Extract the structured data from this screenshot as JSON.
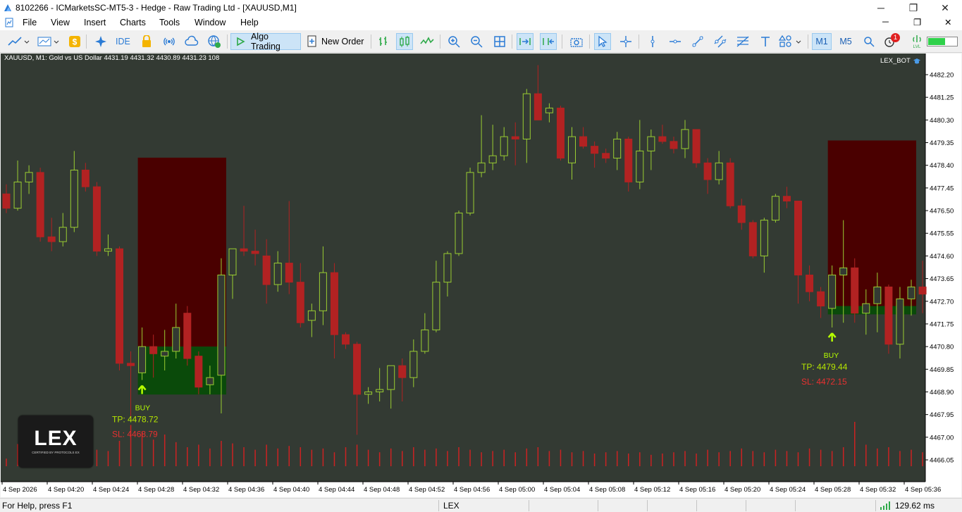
{
  "window": {
    "title": "8102266 - ICMarketsSC-MT5-3 - Hedge - Raw Trading Ltd - [XAUUSD,M1]",
    "minimize_glyph": "─",
    "maximize_glyph": "❐",
    "close_glyph": "✕"
  },
  "menu": [
    "File",
    "View",
    "Insert",
    "Charts",
    "Tools",
    "Window",
    "Help"
  ],
  "toolbar": {
    "ide_label": "IDE",
    "algo_trading_label": "Algo Trading",
    "new_order_label": "New Order",
    "timeframe_m1": "M1",
    "timeframe_m5": "M5",
    "notification_count": "1",
    "icons": [
      "new-chart-icon",
      "chart-profiles-icon",
      "market-icon",
      "strategy-tester-icon",
      "ide-icon",
      "signals-icon",
      "radio-icon",
      "cloud-icon",
      "vps-icon",
      "play-icon",
      "new-order-icon",
      "bar-chart-icon",
      "candles-icon",
      "line-chart-icon",
      "zoom-in-icon",
      "zoom-out-icon",
      "tile-icon",
      "autoscroll-icon",
      "chart-shift-icon",
      "screenshot-icon",
      "cursor-icon",
      "crosshair-icon",
      "vertical-line-icon",
      "horizontal-line-icon",
      "trendline-icon",
      "channel-icon",
      "fibonacci-icon",
      "text-icon",
      "shapes-icon",
      "search-icon",
      "bell-icon",
      "signal-icon",
      "connection-bar-icon"
    ]
  },
  "chart": {
    "header": "XAUUSD, M1:  Gold vs US Dollar  4431.19 4431.32 4430.89 4431.23  108",
    "expert_label": "LEX_BOT",
    "logo_text": "LEX",
    "logo_subtext": "CERTIFIED BY PROTOCOLS EX",
    "signals": [
      {
        "label": "BUY",
        "tp": "TP: 4478.72",
        "sl": "SL: 4468.79"
      },
      {
        "label": "BUY",
        "tp": "TP: 4479.44",
        "sl": "SL: 4472.15"
      }
    ],
    "colors": {
      "background": "#333a33",
      "bull_candle": "#9acd32",
      "bear_candle": "#b22222",
      "volume": "#cc2222",
      "tp_zone": "#4a0000",
      "sl_zone": "#0a4a0a",
      "buy_arrow": "#b6ff00",
      "tp_text": "#b6e600",
      "sl_text": "#e83030"
    }
  },
  "chart_data": {
    "type": "candlestick",
    "symbol": "XAUUSD",
    "timeframe": "M1",
    "yticks": [
      "4482.20",
      "4481.25",
      "4480.30",
      "4479.35",
      "4478.40",
      "4477.45",
      "4476.50",
      "4475.55",
      "4474.60",
      "4473.65",
      "4472.70",
      "4471.75",
      "4470.80",
      "4469.85",
      "4468.90",
      "4467.95",
      "4467.00",
      "4466.05"
    ],
    "xticks": [
      "4 Sep 2026",
      "4 Sep 04:20",
      "4 Sep 04:24",
      "4 Sep 04:28",
      "4 Sep 04:32",
      "4 Sep 04:36",
      "4 Sep 04:40",
      "4 Sep 04:44",
      "4 Sep 04:48",
      "4 Sep 04:52",
      "4 Sep 04:56",
      "4 Sep 05:00",
      "4 Sep 05:04",
      "4 Sep 05:08",
      "4 Sep 05:12",
      "4 Sep 05:16",
      "4 Sep 05:20",
      "4 Sep 05:24",
      "4 Sep 05:28",
      "4 Sep 05:32",
      "4 Sep 05:36"
    ],
    "ylim": [
      4465.9,
      4482.6
    ],
    "candles": [
      [
        4477.2,
        4477.6,
        4476.4,
        4476.6
      ],
      [
        4476.6,
        4478.6,
        4476.5,
        4477.7
      ],
      [
        4477.7,
        4478.4,
        4477.2,
        4478.1
      ],
      [
        4478.1,
        4478.3,
        4475.2,
        4475.4
      ],
      [
        4475.4,
        4476.2,
        4474.8,
        4475.2
      ],
      [
        4475.2,
        4476.4,
        4475.0,
        4475.8
      ],
      [
        4475.8,
        4479.0,
        4475.6,
        4478.2
      ],
      [
        4478.2,
        4478.5,
        4477.3,
        4477.5
      ],
      [
        4477.5,
        4477.7,
        4474.6,
        4474.8
      ],
      [
        4474.8,
        4475.5,
        4474.6,
        4474.9
      ],
      [
        4474.9,
        4475.0,
        4469.8,
        4470.1
      ],
      [
        4470.1,
        4470.6,
        4467.8,
        4470.0
      ],
      [
        4469.7,
        4471.6,
        4469.4,
        4470.8
      ],
      [
        4470.8,
        4471.3,
        4469.5,
        4470.5
      ],
      [
        4470.4,
        4471.5,
        4469.8,
        4470.6
      ],
      [
        4470.6,
        4472.6,
        4470.3,
        4471.6
      ],
      [
        4472.2,
        4472.5,
        4470.0,
        4470.3
      ],
      [
        4470.4,
        4470.6,
        4468.8,
        4469.1
      ],
      [
        4469.2,
        4470.0,
        4468.8,
        4469.5
      ],
      [
        4469.6,
        4474.5,
        4468.0,
        4473.8
      ],
      [
        4473.8,
        4474.8,
        4472.8,
        4474.9
      ],
      [
        4474.9,
        4476.7,
        4474.6,
        4474.8
      ],
      [
        4474.8,
        4475.7,
        4474.2,
        4474.7
      ],
      [
        4474.6,
        4475.3,
        4472.6,
        4473.4
      ],
      [
        4473.4,
        4474.8,
        4473.1,
        4474.3
      ],
      [
        4474.3,
        4476.9,
        4473.0,
        4473.5
      ],
      [
        4473.5,
        4474.3,
        4471.6,
        4471.8
      ],
      [
        4471.9,
        4472.6,
        4471.2,
        4472.3
      ],
      [
        4472.3,
        4475.0,
        4471.7,
        4473.9
      ],
      [
        4473.9,
        4474.3,
        4470.3,
        4471.3
      ],
      [
        4471.3,
        4471.4,
        4470.7,
        4470.9
      ],
      [
        4470.9,
        4471.0,
        4467.1,
        4468.8
      ],
      [
        4468.8,
        4469.1,
        4468.4,
        4468.9
      ],
      [
        4468.9,
        4469.9,
        4468.5,
        4469.0
      ],
      [
        4469.0,
        4470.0,
        4468.2,
        4470.0
      ],
      [
        4470.0,
        4470.3,
        4468.5,
        4469.5
      ],
      [
        4469.5,
        4471.1,
        4469.1,
        4470.6
      ],
      [
        4470.6,
        4472.2,
        4470.5,
        4471.5
      ],
      [
        4471.5,
        4474.4,
        4471.4,
        4473.5
      ],
      [
        4473.5,
        4474.8,
        4472.9,
        4474.7
      ],
      [
        4474.7,
        4476.5,
        4474.6,
        4476.4
      ],
      [
        4476.4,
        4478.3,
        4476.3,
        4478.1
      ],
      [
        4478.1,
        4480.5,
        4477.9,
        4478.5
      ],
      [
        4478.5,
        4480.1,
        4478.2,
        4478.8
      ],
      [
        4478.8,
        4480.0,
        4478.6,
        4479.6
      ],
      [
        4479.6,
        4480.2,
        4478.4,
        4479.5
      ],
      [
        4479.5,
        4481.6,
        4478.5,
        4481.4
      ],
      [
        4481.4,
        4482.6,
        4480.3,
        4480.3
      ],
      [
        4480.6,
        4481.0,
        4480.2,
        4480.8
      ],
      [
        4480.8,
        4480.9,
        4478.6,
        4478.7
      ],
      [
        4478.5,
        4480.0,
        4477.8,
        4479.6
      ],
      [
        4479.6,
        4480.0,
        4479.1,
        4479.2
      ],
      [
        4479.2,
        4479.4,
        4478.3,
        4478.9
      ],
      [
        4478.9,
        4479.1,
        4478.5,
        4478.7
      ],
      [
        4478.7,
        4479.8,
        4478.2,
        4479.5
      ],
      [
        4479.5,
        4479.6,
        4477.3,
        4477.7
      ],
      [
        4477.7,
        4480.3,
        4477.4,
        4479.0
      ],
      [
        4479.0,
        4479.9,
        4478.2,
        4479.6
      ],
      [
        4479.6,
        4480.1,
        4479.3,
        4479.4
      ],
      [
        4479.4,
        4479.6,
        4478.9,
        4479.1
      ],
      [
        4479.1,
        4480.3,
        4478.7,
        4479.9
      ],
      [
        4479.9,
        4479.9,
        4478.3,
        4478.5
      ],
      [
        4478.5,
        4478.7,
        4477.2,
        4477.8
      ],
      [
        4477.8,
        4479.0,
        4477.6,
        4478.5
      ],
      [
        4478.5,
        4478.7,
        4476.6,
        4476.7
      ],
      [
        4476.7,
        4477.0,
        4475.7,
        4476.0
      ],
      [
        4476.0,
        4476.1,
        4474.5,
        4474.6
      ],
      [
        4474.6,
        4476.2,
        4473.9,
        4476.1
      ],
      [
        4476.1,
        4477.2,
        4476.0,
        4477.1
      ],
      [
        4477.1,
        4477.5,
        4476.6,
        4476.9
      ],
      [
        4476.9,
        4476.9,
        4472.6,
        4473.8
      ],
      [
        4473.8,
        4474.2,
        4472.7,
        4473.1
      ],
      [
        4473.1,
        4473.3,
        4472.0,
        4472.5
      ],
      [
        4472.4,
        4474.2,
        4471.6,
        4473.8
      ],
      [
        4473.8,
        4476.1,
        4471.8,
        4474.1
      ],
      [
        4474.1,
        4474.5,
        4471.8,
        4472.2
      ],
      [
        4472.2,
        4473.2,
        4471.3,
        4472.6
      ],
      [
        4472.6,
        4473.9,
        4471.4,
        4473.3
      ],
      [
        4473.3,
        4473.4,
        4470.5,
        4470.9
      ],
      [
        4470.9,
        4473.3,
        4470.3,
        4472.8
      ],
      [
        4472.8,
        4473.6,
        4472.1,
        4473.3
      ],
      [
        4473.3,
        4474.4,
        4472.2,
        4473.0
      ]
    ],
    "volume": [
      12,
      35,
      20,
      25,
      30,
      22,
      28,
      18,
      26,
      24,
      40,
      65,
      55,
      42,
      50,
      38,
      30,
      34,
      28,
      40,
      36,
      30,
      26,
      34,
      28,
      32,
      30,
      26,
      28,
      22,
      30,
      34,
      26,
      22,
      28,
      24,
      30,
      26,
      28,
      24,
      30,
      26,
      22,
      24,
      26,
      22,
      28,
      30,
      24,
      26,
      22,
      24,
      20,
      22,
      24,
      20,
      22,
      18,
      20,
      22,
      24,
      20,
      26,
      22,
      24,
      28,
      24,
      22,
      26,
      24,
      22,
      28,
      26,
      24,
      30,
      70,
      34,
      28,
      30,
      24,
      26,
      22
    ],
    "positions": [
      {
        "side": "BUY",
        "tp": 4478.72,
        "sl": 4468.79,
        "entry_label": "BUY"
      },
      {
        "side": "BUY",
        "tp": 4479.44,
        "sl": 4472.15,
        "entry_label": "BUY"
      }
    ]
  },
  "status": {
    "help_text": "For Help, press F1",
    "profile": "LEX",
    "ping": "129.62 ms"
  }
}
